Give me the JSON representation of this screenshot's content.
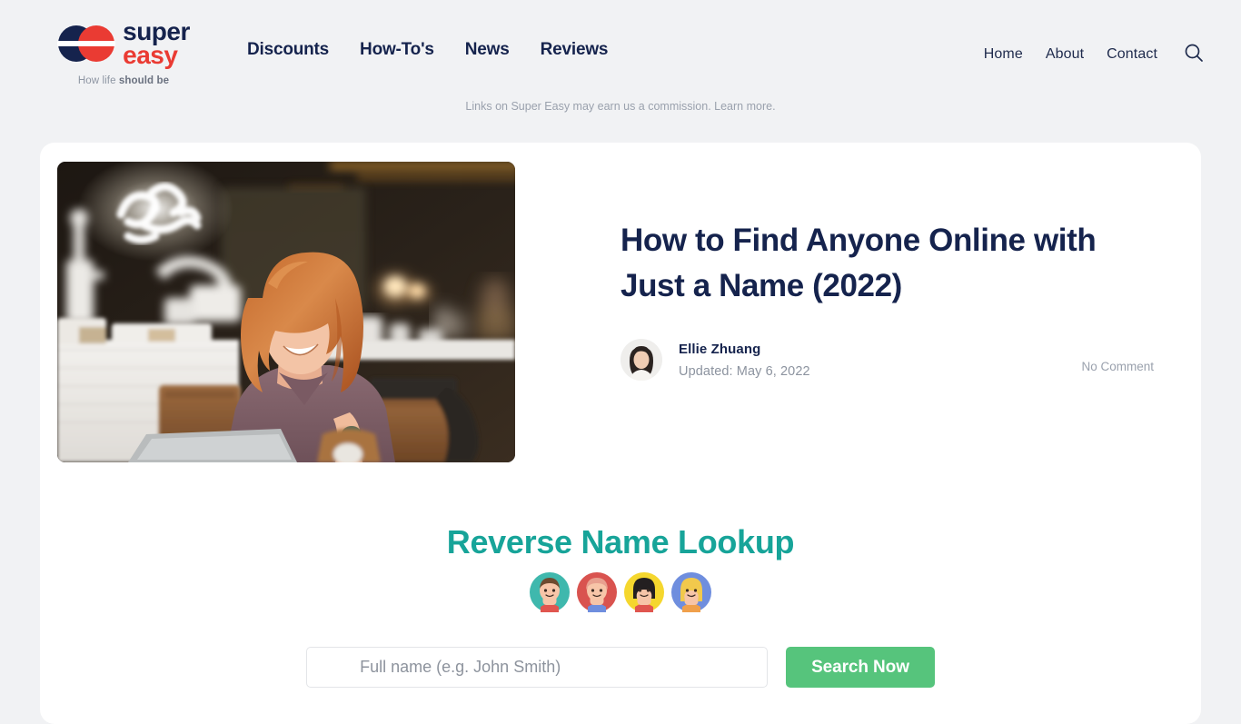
{
  "header": {
    "logo": {
      "name_part1": "super",
      "name_part2": "easy",
      "tagline_regular": "How life ",
      "tagline_bold": "should be",
      "mark_color_left": "#15234d",
      "mark_color_right": "#ea3b33"
    },
    "main_nav": [
      {
        "label": "Discounts"
      },
      {
        "label": "How-To's"
      },
      {
        "label": "News"
      },
      {
        "label": "Reviews"
      }
    ],
    "util_nav": [
      {
        "label": "Home"
      },
      {
        "label": "About"
      },
      {
        "label": "Contact"
      }
    ],
    "search_icon": "search-icon"
  },
  "disclaimer": {
    "text": "Links on Super Easy may earn us a commission. ",
    "link_label": "Learn more."
  },
  "article": {
    "title": "How to Find Anyone Online with Just a Name (2022)",
    "author": "Ellie Zhuang",
    "updated": "Updated: May 6, 2022",
    "comments": "No Comment",
    "hero_alt": "woman-with-laptop-in-cafe"
  },
  "lookup": {
    "title": "Reverse Name Lookup",
    "avatars": [
      {
        "name": "avatar-teal",
        "bg": "#3fb8ad",
        "hair": "#6d4a2f",
        "skin": "#f7c5a8"
      },
      {
        "name": "avatar-red",
        "bg": "#d9534f",
        "hair": "#e8a08f",
        "skin": "#f7c5a8"
      },
      {
        "name": "avatar-yellow",
        "bg": "#f5d72e",
        "hair": "#231f20",
        "skin": "#f7c5a8"
      },
      {
        "name": "avatar-blue",
        "bg": "#6f8ede",
        "hair": "#f2c94c",
        "skin": "#f7c5a8"
      }
    ],
    "input_placeholder": "Full name (e.g. John Smith)",
    "input_value": "",
    "submit_label": "Search Now",
    "accent_color": "#17a499",
    "button_color": "#56c47c"
  }
}
